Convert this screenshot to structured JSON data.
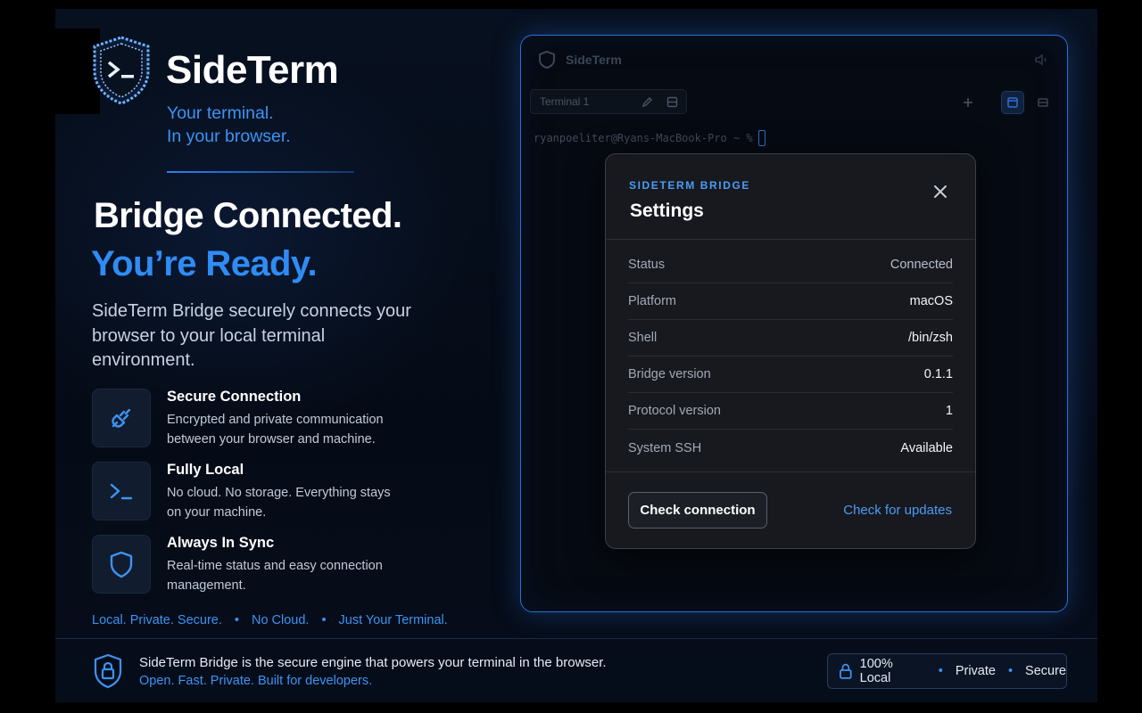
{
  "brand": {
    "name": "SideTerm",
    "tagline_1": "Your terminal.",
    "tagline_2": "In your browser."
  },
  "hero": {
    "headline_1": "Bridge Connected.",
    "headline_2": "You’re Ready.",
    "lead": "SideTerm Bridge securely connects your browser to your local terminal environment."
  },
  "features": [
    {
      "icon": "plug-icon",
      "title": "Secure Connection",
      "desc": "Encrypted and private communication between your browser and machine."
    },
    {
      "icon": "terminal-prompt-icon",
      "title": "Fully Local",
      "desc": "No cloud. No storage. Everything stays on your machine."
    },
    {
      "icon": "shield-icon",
      "title": "Always In Sync",
      "desc": "Real-time status and easy connection management."
    }
  ],
  "motto": {
    "a": "Local. Private. Secure.",
    "b": "No Cloud.",
    "c": "Just Your Terminal.",
    "dot": "•"
  },
  "footer": {
    "text": "SideTerm Bridge is the secure engine that powers your terminal in the browser.",
    "sub": "Open. Fast. Private. Built for developers.",
    "pill": {
      "a": "100% Local",
      "b": "Private",
      "c": "Secure",
      "dot": "•"
    }
  },
  "terminal": {
    "title": "SideTerm",
    "tab_label": "Terminal 1",
    "prompt": "ryanpoeliter@Ryans-MacBook-Pro ~ %"
  },
  "modal": {
    "kicker": "SIDETERM BRIDGE",
    "title": "Settings",
    "rows": [
      {
        "label": "Status",
        "value": "Connected"
      },
      {
        "label": "Platform",
        "value": "macOS"
      },
      {
        "label": "Shell",
        "value": "/bin/zsh"
      },
      {
        "label": "Bridge version",
        "value": "0.1.1"
      },
      {
        "label": "Protocol version",
        "value": "1"
      },
      {
        "label": "System SSH",
        "value": "Available"
      }
    ],
    "check_button": "Check connection",
    "update_link": "Check for updates"
  },
  "colors": {
    "accent": "#2f8cf5",
    "link": "#4b9cf5",
    "bg": "#07101f",
    "modal_bg": "#17191f"
  }
}
